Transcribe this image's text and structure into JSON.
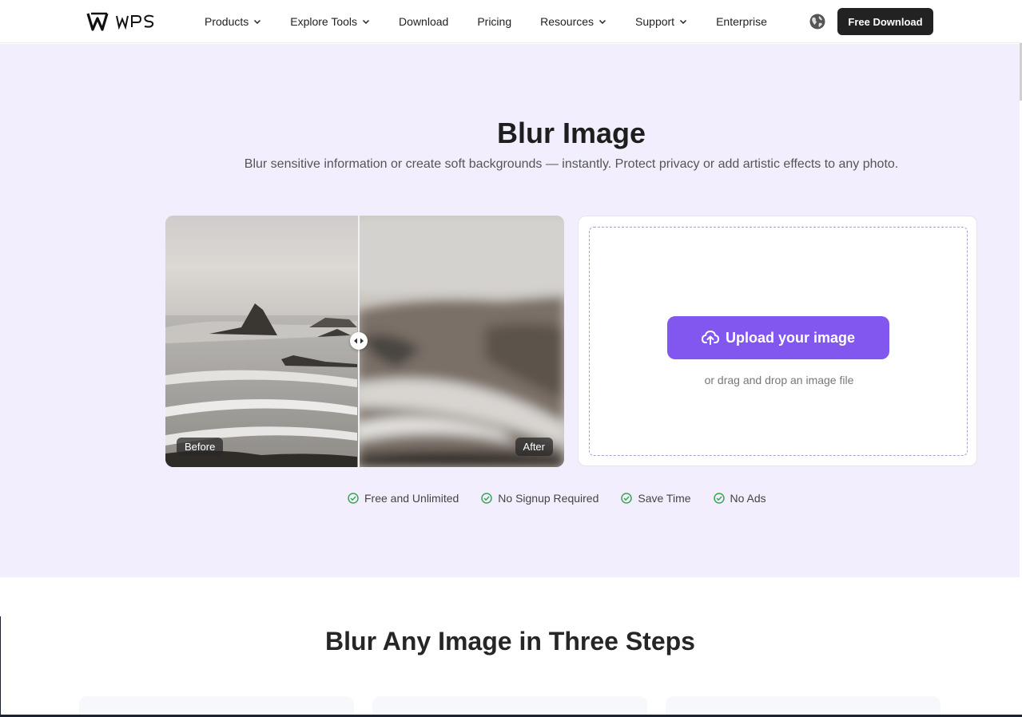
{
  "header": {
    "logo_text": "WPS",
    "nav": [
      {
        "label": "Products",
        "dropdown": true
      },
      {
        "label": "Explore Tools",
        "dropdown": true
      },
      {
        "label": "Download",
        "dropdown": false
      },
      {
        "label": "Pricing",
        "dropdown": false
      },
      {
        "label": "Resources",
        "dropdown": true
      },
      {
        "label": "Support",
        "dropdown": true
      },
      {
        "label": "Enterprise",
        "dropdown": false
      }
    ],
    "language_icon": "globe-icon",
    "cta_label": "Free Download"
  },
  "hero": {
    "title": "Blur Image",
    "subtitle": "Blur sensitive information or create soft backgrounds — instantly. Protect privacy or add artistic effects to any photo.",
    "compare": {
      "before_label": "Before",
      "after_label": "After"
    },
    "upload": {
      "button_label": "Upload your image",
      "drag_text": "or drag and drop an image file",
      "icon": "cloud-upload-icon"
    },
    "features": [
      "Free and Unlimited",
      "No Signup Required",
      "Save Time",
      "No Ads"
    ]
  },
  "steps": {
    "title": "Blur Any Image in Three Steps"
  },
  "colors": {
    "accent": "#8257f0",
    "hero_bg": "#f2eefd",
    "check": "#3aa655",
    "dark_button": "#222222"
  }
}
